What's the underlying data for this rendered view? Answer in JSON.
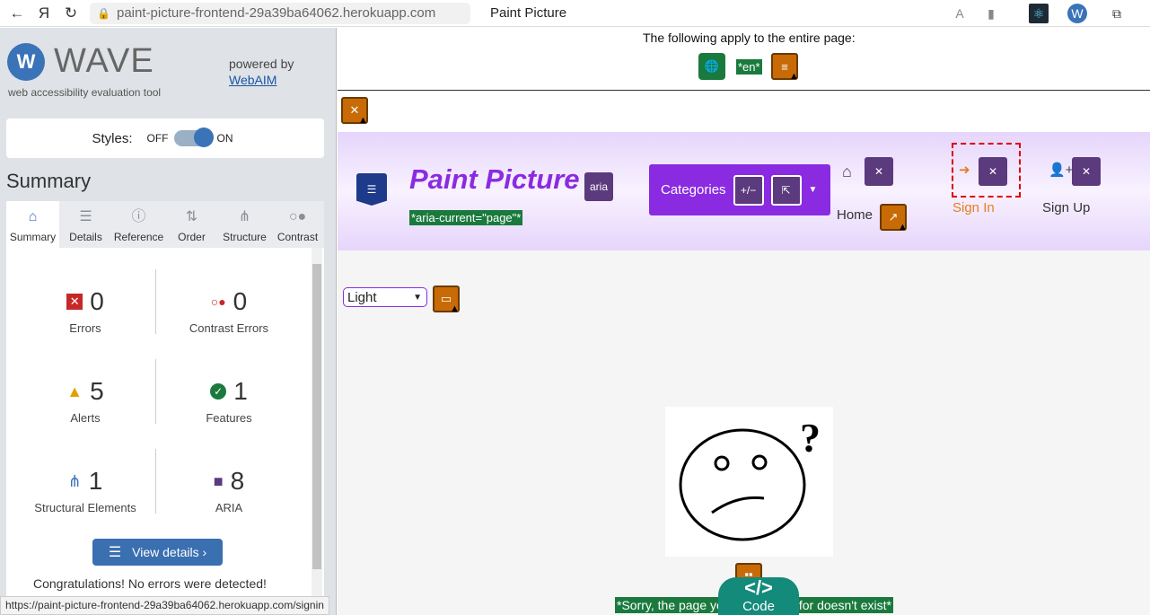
{
  "browser": {
    "url": "paint-picture-frontend-29a39ba64062.herokuapp.com",
    "tab_title": "Paint Picture"
  },
  "wave": {
    "logo_text": "WAVE",
    "subtitle": "web accessibility evaluation tool",
    "powered_by": "powered by",
    "webaim_link": "WebAIM",
    "styles_label": "Styles:",
    "styles_off": "OFF",
    "styles_on": "ON",
    "summary_heading": "Summary",
    "tabs": [
      {
        "label": "Summary",
        "icon": "home-icon"
      },
      {
        "label": "Details",
        "icon": "list-icon"
      },
      {
        "label": "Reference",
        "icon": "info-icon"
      },
      {
        "label": "Order",
        "icon": "order-icon"
      },
      {
        "label": "Structure",
        "icon": "structure-icon"
      },
      {
        "label": "Contrast",
        "icon": "contrast-icon"
      }
    ],
    "stats": {
      "errors": {
        "count": "0",
        "label": "Errors"
      },
      "contrast_errors": {
        "count": "0",
        "label": "Contrast Errors"
      },
      "alerts": {
        "count": "5",
        "label": "Alerts"
      },
      "features": {
        "count": "1",
        "label": "Features"
      },
      "structural": {
        "count": "1",
        "label": "Structural Elements"
      },
      "aria": {
        "count": "8",
        "label": "ARIA"
      }
    },
    "view_details": "View details ›",
    "congrats": "Congratulations! No errors were detected!",
    "status_url": "https://paint-picture-frontend-29a39ba64062.herokuapp.com/signin"
  },
  "page": {
    "entire_page_text": "The following apply to the entire page:",
    "lang_tag": "*en*",
    "aria_current_tag": "*aria-current=\"page\"*",
    "aria_label": "aria",
    "brand": "Paint Picture",
    "categories": "Categories",
    "nav": {
      "home": "Home",
      "sign_in": "Sign In",
      "sign_up": "Sign Up"
    },
    "theme_value": "Light",
    "sorry_text": "*Sorry, the page you are looking for doesn't exist*",
    "code_label": "Code"
  },
  "colors": {
    "accent_purple": "#8a2be2",
    "wave_blue": "#3a73b8",
    "feature_green": "#1a7a3e",
    "alert_orange": "#c86a05"
  }
}
